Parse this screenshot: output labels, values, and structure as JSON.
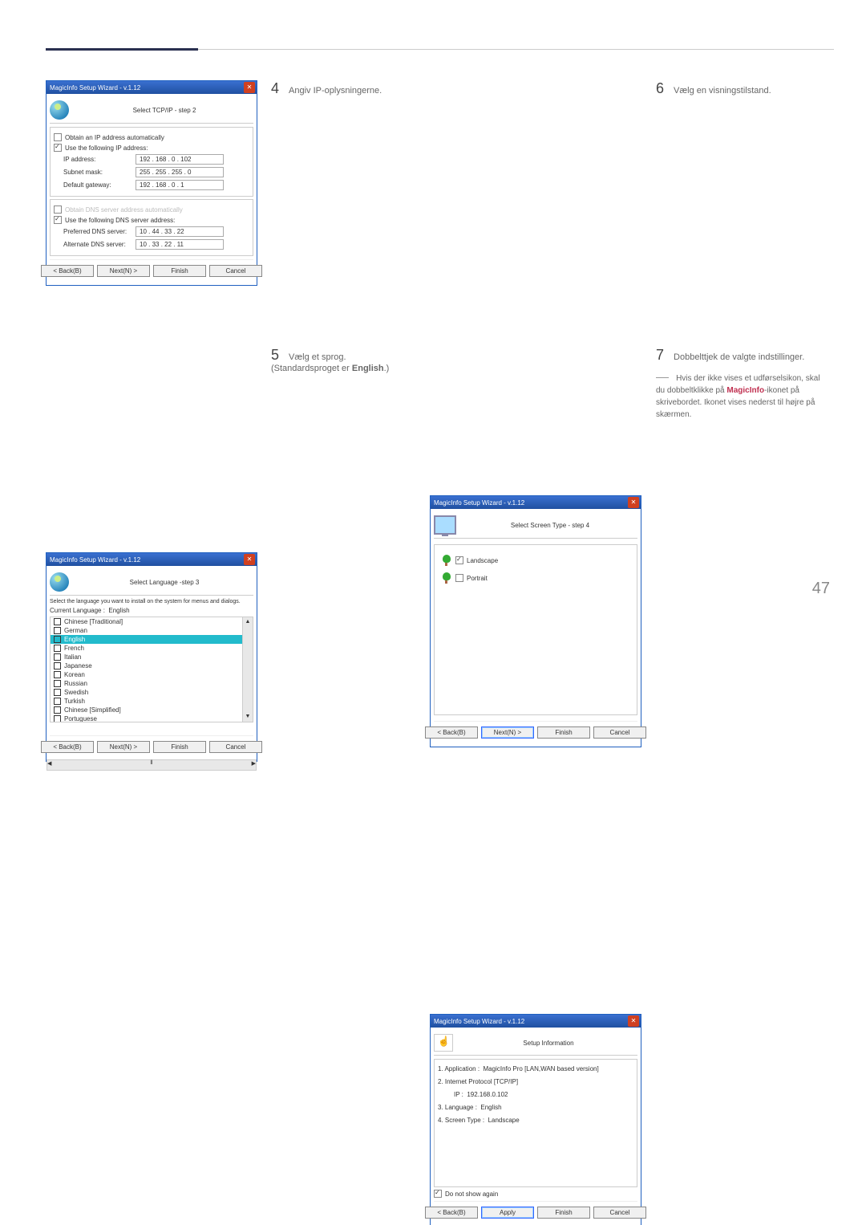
{
  "pageNumber": "47",
  "wizardTitle": "MagicInfo Setup Wizard - v.1.12",
  "steps": {
    "s4": {
      "num": "4",
      "text": "Angiv IP-oplysningerne."
    },
    "s5": {
      "num": "5",
      "text": "Vælg et sprog. (Standardsproget er ",
      "bold": "English",
      "after": ".)"
    },
    "s6": {
      "num": "6",
      "text": "Vælg en visningstilstand."
    },
    "s7": {
      "num": "7",
      "text": "Dobbelttjek de valgte indstillinger."
    }
  },
  "note": {
    "pre": "Hvis der ikke vises et udførselsikon, skal du dobbeltklikke på ",
    "bold": "MagicInfo",
    "post": "-ikonet på skrivebordet. Ikonet vises nederst til højre på skærmen."
  },
  "tcp": {
    "header": "Select TCP/IP - step 2",
    "autoIp": "Obtain an IP address automatically",
    "useIp": "Use the following IP address:",
    "ipL": "IP address:",
    "ipV": "192 . 168 .  0  . 102",
    "smL": "Subnet mask:",
    "smV": "255 . 255 . 255 .  0",
    "gwL": "Default gateway:",
    "gwV": "192 . 168 .  0  .   1",
    "autoDns": "Obtain DNS server address automatically",
    "useDns": "Use the following DNS server address:",
    "pdL": "Preferred DNS server:",
    "pdV": "10 . 44 . 33 . 22",
    "adL": "Alternate DNS server:",
    "adV": "10 . 33 . 22 . 11"
  },
  "lang": {
    "header": "Select Language -step 3",
    "desc": "Select the language you want to install on the system for menus and dialogs.",
    "curL": "Current Language     :",
    "curV": "English",
    "items": [
      "Chinese [Traditional]",
      "German",
      "English",
      "French",
      "Italian",
      "Japanese",
      "Korean",
      "Russian",
      "Swedish",
      "Turkish",
      "Chinese [Simplified]",
      "Portuguese"
    ]
  },
  "screen": {
    "header": "Select Screen Type - step 4",
    "landscape": "Landscape",
    "portrait": "Portrait"
  },
  "info": {
    "header": "Setup Information",
    "l1a": "1. Application    :",
    "l1b": "MagicInfo Pro [LAN,WAN based version]",
    "l2": "2. Internet Protocol [TCP/IP]",
    "l2ipL": "IP  :",
    "l2ipV": "192.168.0.102",
    "l3a": "3. Language   :",
    "l3b": "English",
    "l4a": "4. Screen Type :",
    "l4b": "Landscape",
    "dontShow": "Do not show again"
  },
  "buttons": {
    "back": "< Back(B)",
    "next": "Next(N) >",
    "finish": "Finish",
    "cancel": "Cancel",
    "apply": "Apply"
  }
}
